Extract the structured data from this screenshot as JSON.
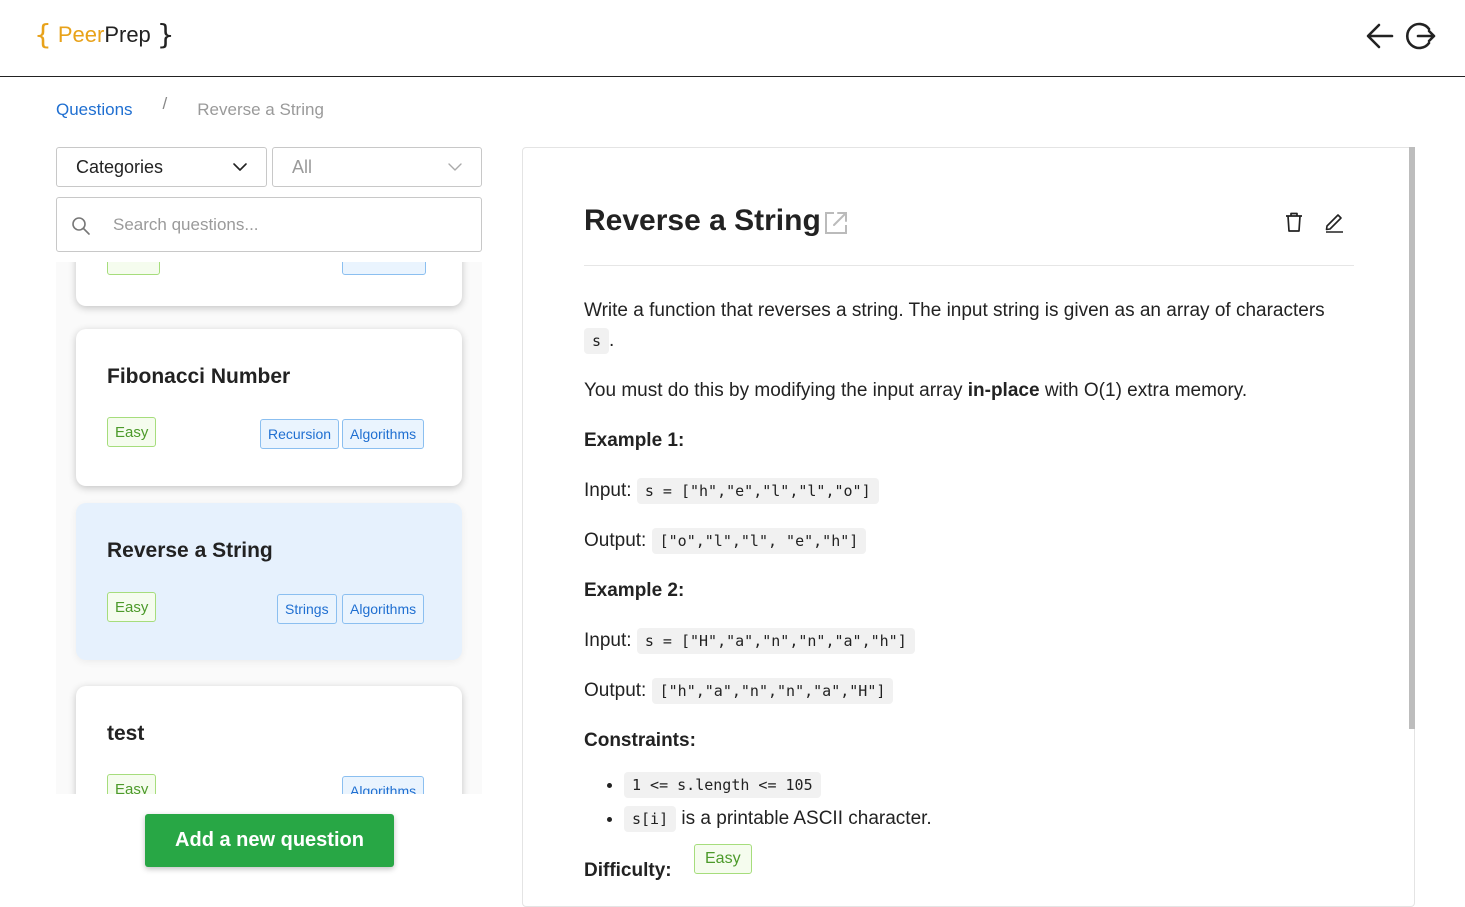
{
  "header": {
    "logo_left_brace": "{",
    "logo_peer": "Peer",
    "logo_prep": "Prep",
    "logo_right_brace": "}",
    "back_icon": "arrow-left-icon",
    "logout_icon": "logout-icon"
  },
  "breadcrumb": {
    "link": "Questions",
    "separator": "/",
    "current": "Reverse a String"
  },
  "filters": {
    "filter_type": "Categories",
    "filter_value": "All",
    "search_placeholder": "Search questions..."
  },
  "question_list": [
    {
      "title": "Fibonacci Number",
      "difficulty": "Easy",
      "tags": [
        "Recursion",
        "Algorithms"
      ],
      "selected": false
    },
    {
      "title": "Reverse a String",
      "difficulty": "Easy",
      "tags": [
        "Strings",
        "Algorithms"
      ],
      "selected": true
    },
    {
      "title": "test",
      "difficulty": "Easy",
      "tags": [
        "Algorithms"
      ],
      "selected": false
    }
  ],
  "add_button": "Add a new question",
  "detail": {
    "title": "Reverse a String",
    "p1_text": "Write a function that reverses a string. The input string is given as an array of characters ",
    "p1_code": "s",
    "p1_end": ".",
    "p2_before": "You must do this by modifying the input array ",
    "p2_bold": "in-place",
    "p2_after": " with O(1) extra memory.",
    "example1_heading": "Example 1:",
    "example1_input_label": "Input:",
    "example1_input": "s = [\"h\",\"e\",\"l\",\"l\",\"o\"]",
    "example1_output_label": "Output:",
    "example1_output": "[\"o\",\"l\",\"l\", \"e\",\"h\"]",
    "example2_heading": "Example 2:",
    "example2_input_label": "Input:",
    "example2_input": "s = [\"H\",\"a\",\"n\",\"n\",\"a\",\"h\"]",
    "example2_output_label": "Output:",
    "example2_output": "[\"h\",\"a\",\"n\",\"n\",\"a\",\"H\"]",
    "constraints_heading": "Constraints:",
    "constraint1_code": "1 <= s.length <= 105",
    "constraint2_code": "s[i]",
    "constraint2_text": " is a printable ASCII character.",
    "difficulty_label": "Difficulty:",
    "difficulty_value": "Easy"
  },
  "colors": {
    "accent_orange": "#e8a21a",
    "link_blue": "#1f6fd1",
    "easy_green": "#4c9a2a",
    "button_green": "#28a745",
    "selected_card": "#e6f1fd"
  }
}
